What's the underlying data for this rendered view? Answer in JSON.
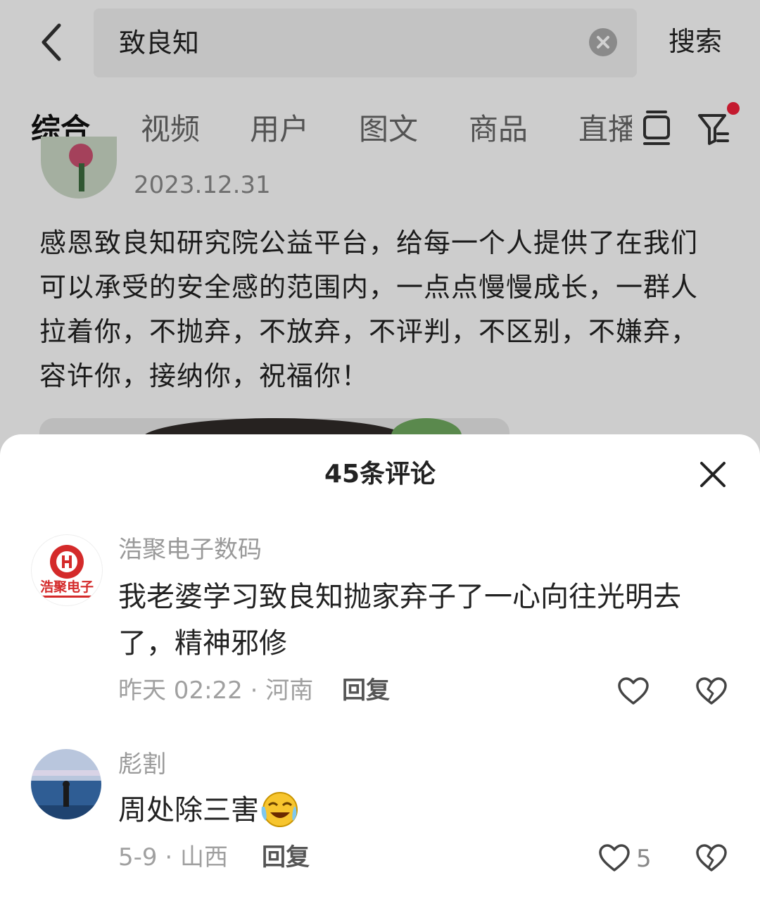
{
  "search": {
    "query": "致良知",
    "search_label": "搜索"
  },
  "tabs": [
    {
      "label": "综合",
      "active": true
    },
    {
      "label": "视频",
      "active": false
    },
    {
      "label": "用户",
      "active": false
    },
    {
      "label": "图文",
      "active": false
    },
    {
      "label": "商品",
      "active": false
    },
    {
      "label": "直播",
      "active": false
    }
  ],
  "post": {
    "date": "2023.12.31",
    "text": "感恩致良知研究院公益平台，给每一个人提供了在我们可以承受的安全感的范围内，一点点慢慢成长，一群人拉着你，不抛弃，不放弃，不评判，不区别，不嫌弃，容许你，接纳你，祝福你！"
  },
  "comments_panel": {
    "title": "45条评论",
    "comments": [
      {
        "author": "浩聚电子数码",
        "avatar_logo_text": "浩聚电子",
        "text": "我老婆学习致良知抛家弃子了一心向往光明去了，精神邪修",
        "meta": "昨天 02:22 · 河南",
        "reply_label": "回复",
        "likes": ""
      },
      {
        "author": "彪割",
        "text": "周处除三害",
        "meta": "5-9 · 山西",
        "reply_label": "回复",
        "likes": "5"
      }
    ]
  },
  "colors": {
    "accent_dot": "#f0203a",
    "sheet_bg": "#ffffff",
    "muted_text": "#999999"
  }
}
